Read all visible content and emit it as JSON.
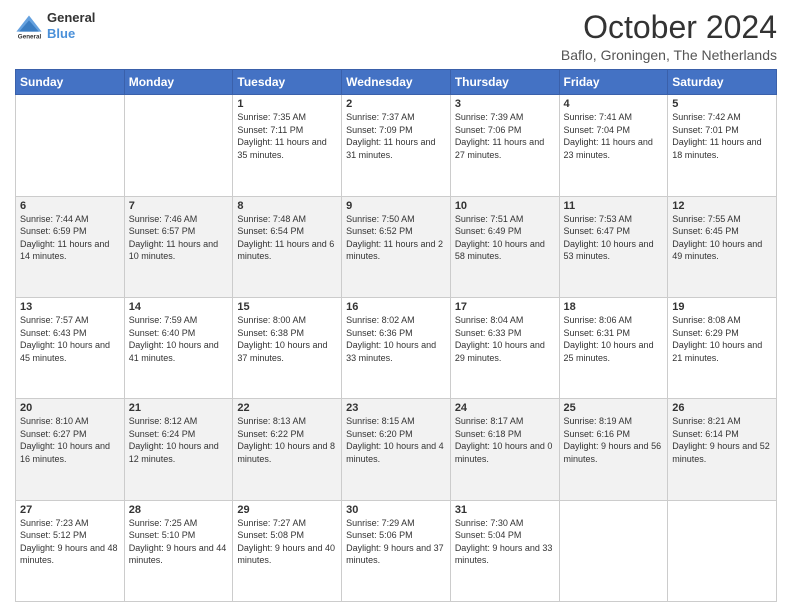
{
  "header": {
    "logo_line1": "General",
    "logo_line2": "Blue",
    "title": "October 2024",
    "subtitle": "Baflo, Groningen, The Netherlands"
  },
  "days_of_week": [
    "Sunday",
    "Monday",
    "Tuesday",
    "Wednesday",
    "Thursday",
    "Friday",
    "Saturday"
  ],
  "weeks": [
    [
      {
        "day": "",
        "info": ""
      },
      {
        "day": "",
        "info": ""
      },
      {
        "day": "1",
        "info": "Sunrise: 7:35 AM\nSunset: 7:11 PM\nDaylight: 11 hours and 35 minutes."
      },
      {
        "day": "2",
        "info": "Sunrise: 7:37 AM\nSunset: 7:09 PM\nDaylight: 11 hours and 31 minutes."
      },
      {
        "day": "3",
        "info": "Sunrise: 7:39 AM\nSunset: 7:06 PM\nDaylight: 11 hours and 27 minutes."
      },
      {
        "day": "4",
        "info": "Sunrise: 7:41 AM\nSunset: 7:04 PM\nDaylight: 11 hours and 23 minutes."
      },
      {
        "day": "5",
        "info": "Sunrise: 7:42 AM\nSunset: 7:01 PM\nDaylight: 11 hours and 18 minutes."
      }
    ],
    [
      {
        "day": "6",
        "info": "Sunrise: 7:44 AM\nSunset: 6:59 PM\nDaylight: 11 hours and 14 minutes."
      },
      {
        "day": "7",
        "info": "Sunrise: 7:46 AM\nSunset: 6:57 PM\nDaylight: 11 hours and 10 minutes."
      },
      {
        "day": "8",
        "info": "Sunrise: 7:48 AM\nSunset: 6:54 PM\nDaylight: 11 hours and 6 minutes."
      },
      {
        "day": "9",
        "info": "Sunrise: 7:50 AM\nSunset: 6:52 PM\nDaylight: 11 hours and 2 minutes."
      },
      {
        "day": "10",
        "info": "Sunrise: 7:51 AM\nSunset: 6:49 PM\nDaylight: 10 hours and 58 minutes."
      },
      {
        "day": "11",
        "info": "Sunrise: 7:53 AM\nSunset: 6:47 PM\nDaylight: 10 hours and 53 minutes."
      },
      {
        "day": "12",
        "info": "Sunrise: 7:55 AM\nSunset: 6:45 PM\nDaylight: 10 hours and 49 minutes."
      }
    ],
    [
      {
        "day": "13",
        "info": "Sunrise: 7:57 AM\nSunset: 6:43 PM\nDaylight: 10 hours and 45 minutes."
      },
      {
        "day": "14",
        "info": "Sunrise: 7:59 AM\nSunset: 6:40 PM\nDaylight: 10 hours and 41 minutes."
      },
      {
        "day": "15",
        "info": "Sunrise: 8:00 AM\nSunset: 6:38 PM\nDaylight: 10 hours and 37 minutes."
      },
      {
        "day": "16",
        "info": "Sunrise: 8:02 AM\nSunset: 6:36 PM\nDaylight: 10 hours and 33 minutes."
      },
      {
        "day": "17",
        "info": "Sunrise: 8:04 AM\nSunset: 6:33 PM\nDaylight: 10 hours and 29 minutes."
      },
      {
        "day": "18",
        "info": "Sunrise: 8:06 AM\nSunset: 6:31 PM\nDaylight: 10 hours and 25 minutes."
      },
      {
        "day": "19",
        "info": "Sunrise: 8:08 AM\nSunset: 6:29 PM\nDaylight: 10 hours and 21 minutes."
      }
    ],
    [
      {
        "day": "20",
        "info": "Sunrise: 8:10 AM\nSunset: 6:27 PM\nDaylight: 10 hours and 16 minutes."
      },
      {
        "day": "21",
        "info": "Sunrise: 8:12 AM\nSunset: 6:24 PM\nDaylight: 10 hours and 12 minutes."
      },
      {
        "day": "22",
        "info": "Sunrise: 8:13 AM\nSunset: 6:22 PM\nDaylight: 10 hours and 8 minutes."
      },
      {
        "day": "23",
        "info": "Sunrise: 8:15 AM\nSunset: 6:20 PM\nDaylight: 10 hours and 4 minutes."
      },
      {
        "day": "24",
        "info": "Sunrise: 8:17 AM\nSunset: 6:18 PM\nDaylight: 10 hours and 0 minutes."
      },
      {
        "day": "25",
        "info": "Sunrise: 8:19 AM\nSunset: 6:16 PM\nDaylight: 9 hours and 56 minutes."
      },
      {
        "day": "26",
        "info": "Sunrise: 8:21 AM\nSunset: 6:14 PM\nDaylight: 9 hours and 52 minutes."
      }
    ],
    [
      {
        "day": "27",
        "info": "Sunrise: 7:23 AM\nSunset: 5:12 PM\nDaylight: 9 hours and 48 minutes."
      },
      {
        "day": "28",
        "info": "Sunrise: 7:25 AM\nSunset: 5:10 PM\nDaylight: 9 hours and 44 minutes."
      },
      {
        "day": "29",
        "info": "Sunrise: 7:27 AM\nSunset: 5:08 PM\nDaylight: 9 hours and 40 minutes."
      },
      {
        "day": "30",
        "info": "Sunrise: 7:29 AM\nSunset: 5:06 PM\nDaylight: 9 hours and 37 minutes."
      },
      {
        "day": "31",
        "info": "Sunrise: 7:30 AM\nSunset: 5:04 PM\nDaylight: 9 hours and 33 minutes."
      },
      {
        "day": "",
        "info": ""
      },
      {
        "day": "",
        "info": ""
      }
    ]
  ]
}
